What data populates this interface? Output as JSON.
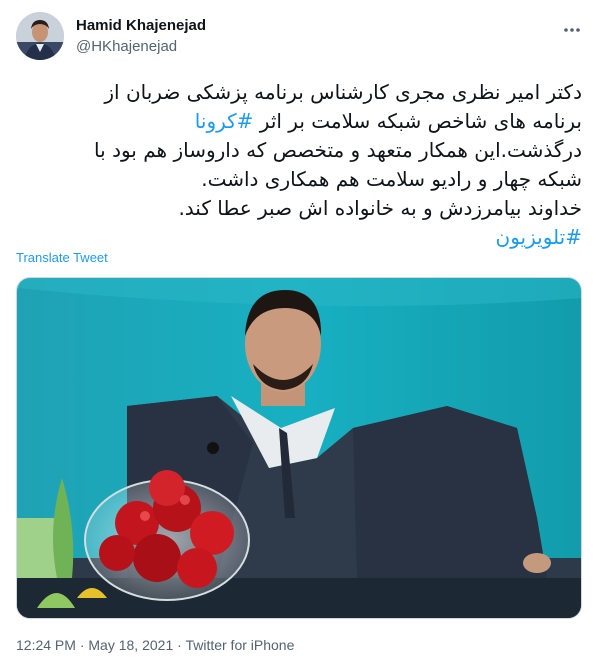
{
  "author": {
    "display_name": "Hamid Khajenejad",
    "handle": "@HKhajenejad"
  },
  "tweet": {
    "line1": "دکتر امیر نظری مجری کارشناس برنامه پزشکی ضربان از",
    "line2_text": "برنامه های شاخص شبکه سلامت بر اثر ",
    "line2_hashtag": "#کرونا",
    "line3": "درگذشت.این همکار متعهد و متخصص که داروساز هم بود با",
    "line4": "شبکه چهار و رادیو سلامت هم همکاری داشت.",
    "line5": "خداوند بیامرزدش و به خانواده اش صبر عطا کند.",
    "line6_hashtag": "#تلویزیون",
    "translate_label": "Translate Tweet"
  },
  "meta": {
    "time": "12:24 PM",
    "separator1": " · ",
    "date": "May 18, 2021",
    "separator2": " · ",
    "source": "Twitter for iPhone"
  },
  "icons": {
    "more": "more-horizontal-icon"
  },
  "colors": {
    "link": "#1d9bf0",
    "secondary_text": "#536471",
    "primary_text": "#0f1419"
  }
}
